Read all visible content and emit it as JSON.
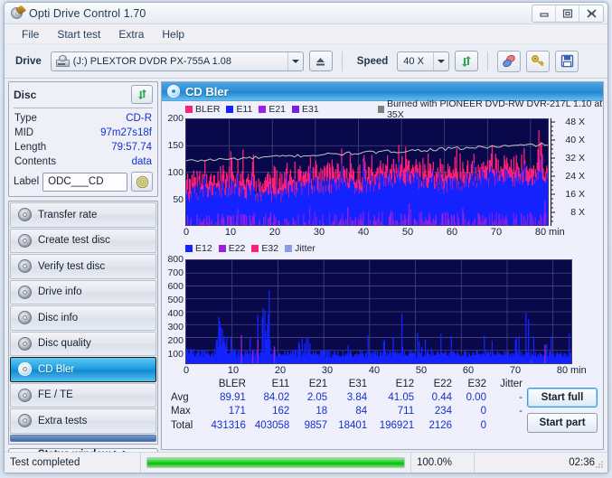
{
  "window": {
    "title": "Opti Drive Control 1.70",
    "icon": "disc-pen-icon",
    "buttons": {
      "minimize": "minimize-icon",
      "maximize": "maximize-icon",
      "close": "close-icon"
    }
  },
  "menu": {
    "items": [
      "File",
      "Start test",
      "Extra",
      "Help"
    ]
  },
  "toolbar": {
    "drive_label": "Drive",
    "drive_value": "(J:)  PLEXTOR DVDR  PX-755A 1.08",
    "eject_icon": "eject-icon",
    "speed_label": "Speed",
    "speed_value": "40 X",
    "refresh_icon": "refresh-icon",
    "erase_icon": "erase-icon",
    "key_icon": "key-icon",
    "save_icon": "save-icon"
  },
  "disc": {
    "title": "Disc",
    "refresh_icon": "refresh-icon",
    "rows": [
      {
        "key": "Type",
        "value": "CD-R"
      },
      {
        "key": "MID",
        "value": "97m27s18f"
      },
      {
        "key": "Length",
        "value": "79:57.74"
      },
      {
        "key": "Contents",
        "value": "data"
      }
    ],
    "label_key": "Label",
    "label_value": "ODC___CD",
    "label_placeholder": "",
    "cd_icon": "cd-icon"
  },
  "nav": {
    "items": [
      {
        "label": "Transfer rate",
        "icon": "disc-speed-icon",
        "active": false
      },
      {
        "label": "Create test disc",
        "icon": "disc-burn-icon",
        "active": false
      },
      {
        "label": "Verify test disc",
        "icon": "disc-check-icon",
        "active": false
      },
      {
        "label": "Drive info",
        "icon": "disc-info-icon",
        "active": false
      },
      {
        "label": "Disc info",
        "icon": "disc-data-icon",
        "active": false
      },
      {
        "label": "Disc quality",
        "icon": "disc-quality-icon",
        "active": false
      },
      {
        "label": "CD Bler",
        "icon": "disc-bler-icon",
        "active": true
      },
      {
        "label": "FE / TE",
        "icon": "disc-fete-icon",
        "active": false
      },
      {
        "label": "Extra tests",
        "icon": "disc-extra-icon",
        "active": false
      }
    ],
    "status_window_button": "Status window > >"
  },
  "main": {
    "title": "CD Bler",
    "title_icon": "disc-bler-icon"
  },
  "chart_data": [
    {
      "type": "area",
      "id": "bler-chart",
      "title": "CD Bler",
      "annotation": "Burned with PIONEER DVD-RW  DVR-217L 1.10 at 35X",
      "annotation_swatch": "#7d7d7d",
      "legend": [
        {
          "name": "BLER",
          "color": "#ff1f7a"
        },
        {
          "name": "E11",
          "color": "#1423ff"
        },
        {
          "name": "E21",
          "color": "#9b1fe0"
        },
        {
          "name": "E31",
          "color": "#7b1fe8"
        }
      ],
      "legend_position": "top-left",
      "grid": true,
      "background": "#08084a",
      "xlabel": "min",
      "x_ticks": [
        0,
        10,
        20,
        30,
        40,
        50,
        60,
        70,
        80
      ],
      "xlim": [
        0,
        84
      ],
      "ylabel": "",
      "y_ticks": [
        50,
        100,
        150,
        200
      ],
      "ylim": [
        0,
        200
      ],
      "y2_label": "X",
      "y2_ticks": [
        "8 X",
        "16 X",
        "24 X",
        "32 X",
        "40 X",
        "48 X"
      ],
      "y2lim": [
        0,
        52
      ],
      "series": [
        {
          "name": "BLER",
          "color": "#ff1f7a",
          "avg": 89.91,
          "max": 171,
          "total": 431316
        },
        {
          "name": "E11",
          "color": "#1423ff",
          "avg": 84.02,
          "max": 162,
          "total": 403058
        },
        {
          "name": "E21",
          "color": "#9b1fe0",
          "avg": 2.05,
          "max": 18,
          "total": 9857
        },
        {
          "name": "E31",
          "color": "#7b1fe8",
          "avg": 3.84,
          "max": 84,
          "total": 18401
        },
        {
          "name": "Speed",
          "color": "#b9b9b9",
          "description": "read speed trace rising from ~32X to ~40X"
        }
      ]
    },
    {
      "type": "area",
      "id": "jitter-chart",
      "legend": [
        {
          "name": "E12",
          "color": "#1423ff"
        },
        {
          "name": "E22",
          "color": "#9b1fe0"
        },
        {
          "name": "E32",
          "color": "#ff1f7a"
        },
        {
          "name": "Jitter",
          "color": "#8a9ce8"
        }
      ],
      "legend_position": "top-left",
      "grid": true,
      "background": "#08084a",
      "xlabel": "min",
      "x_ticks": [
        0,
        10,
        20,
        30,
        40,
        50,
        60,
        70,
        80
      ],
      "xlim": [
        0,
        84
      ],
      "y_ticks": [
        100,
        200,
        300,
        400,
        500,
        600,
        700,
        800
      ],
      "ylim": [
        0,
        800
      ],
      "series": [
        {
          "name": "E12",
          "color": "#1423ff",
          "avg": 41.05,
          "max": 711,
          "total": 196921
        },
        {
          "name": "E22",
          "color": "#9b1fe0",
          "avg": 0.44,
          "max": 234,
          "total": 2126
        },
        {
          "name": "E32",
          "color": "#ff1f7a",
          "avg": 0.0,
          "max": 0,
          "total": 0
        },
        {
          "name": "Jitter",
          "color": "#8a9ce8",
          "avg": "-",
          "max": "-",
          "total": ""
        }
      ]
    }
  ],
  "stats": {
    "columns": [
      "",
      "BLER",
      "E11",
      "E21",
      "E31",
      "E12",
      "E22",
      "E32",
      "Jitter"
    ],
    "rows": [
      {
        "label": "Avg",
        "values": [
          "89.91",
          "84.02",
          "2.05",
          "3.84",
          "41.05",
          "0.44",
          "0.00",
          "-"
        ]
      },
      {
        "label": "Max",
        "values": [
          "171",
          "162",
          "18",
          "84",
          "711",
          "234",
          "0",
          "-"
        ]
      },
      {
        "label": "Total",
        "values": [
          "431316",
          "403058",
          "9857",
          "18401",
          "196921",
          "2126",
          "0",
          ""
        ]
      }
    ]
  },
  "actions": {
    "start_full": "Start full",
    "start_part": "Start part"
  },
  "statusbar": {
    "text": "Test completed",
    "percent_label": "100.0%",
    "percent_value": 100,
    "time": "02:36"
  }
}
